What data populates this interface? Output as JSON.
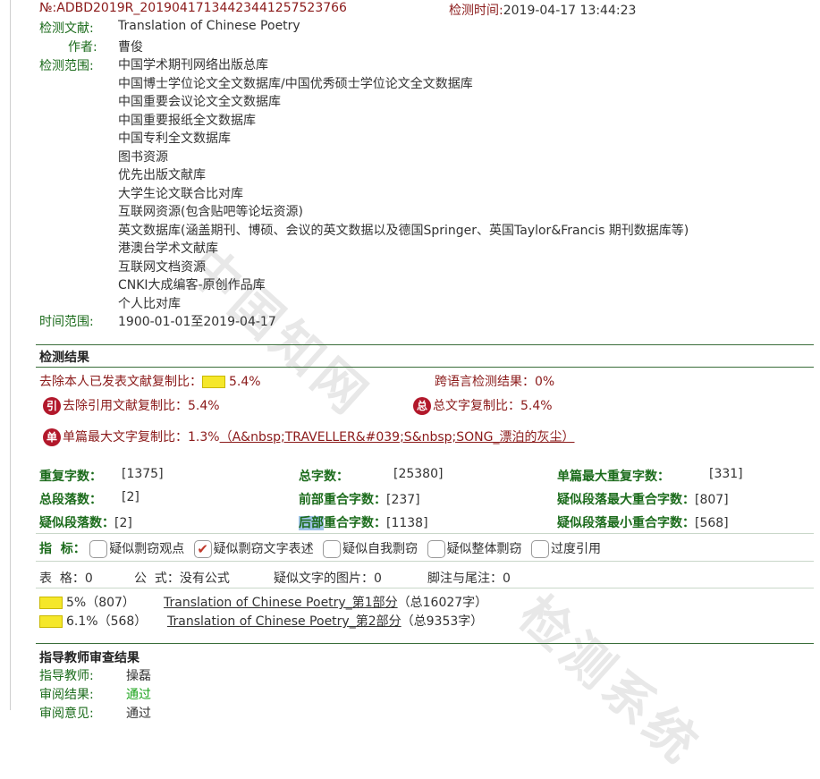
{
  "header": {
    "report_no": "№:ADBD2019R_20190417134423441257523766",
    "time_label": "检测时间:",
    "time_value": "2019-04-17 13:44:23"
  },
  "meta": {
    "doc_label": "检测文献:",
    "doc_value": "Translation of Chinese Poetry",
    "author_label": "作者:",
    "author_value": "曹俊",
    "range_label": "检测范围:",
    "databases": [
      "中国学术期刊网络出版总库",
      "中国博士学位论文全文数据库/中国优秀硕士学位论文全文数据库",
      "中国重要会议论文全文数据库",
      "中国重要报纸全文数据库",
      "中国专利全文数据库",
      "图书资源",
      "优先出版文献库",
      "大学生论文联合比对库",
      "互联网资源(包含贴吧等论坛资源)",
      "英文数据库(涵盖期刊、博硕、会议的英文数据以及德国Springer、英国Taylor&Francis 期刊数据库等)",
      "港澳台学术文献库",
      "互联网文档资源",
      "CNKI大成编客-原创作品库",
      "个人比对库"
    ],
    "time_range_label": "时间范围:",
    "time_range_value": "1900-01-01至2019-04-17"
  },
  "results": {
    "title": "检测结果",
    "self_excluded_label": "去除本人已发表文献复制比：",
    "self_excluded_value": "5.4%",
    "cross_lang": "跨语言检测结果：0%",
    "cite_excluded_badge": "引",
    "cite_excluded_label": "去除引用文献复制比：",
    "cite_excluded_value": "5.4%",
    "total_badge": "总",
    "total_label": "总文字复制比：",
    "total_value": "5.4%",
    "single_badge": "单",
    "single_label": "单篇最大文字复制比：",
    "single_value": "1.3%",
    "single_source": "（A&nbsp;TRAVELLER&#039;S&nbsp;SONG_漂泊的灰尘）",
    "stats": {
      "repeat_chars_label": "重复字数：",
      "repeat_chars_value": "[1375]",
      "total_chars_label": "总字数：",
      "total_chars_value": "[25380]",
      "single_max_label": "单篇最大重复字数：",
      "single_max_value": "[331]",
      "total_paras_label": "总段落数：",
      "total_paras_value": "[2]",
      "front_overlap_label_rest": "前部重合字数：",
      "front_overlap_value": "[237]",
      "susp_para_max_label": "疑似段落最大重合字数：",
      "susp_para_max_value": "[807]",
      "susp_paras_label": "疑似段落数：",
      "susp_paras_value": "[2]",
      "back_overlap_hl": "后部",
      "back_overlap_rest": "重合字数：",
      "back_overlap_value": "[1138]",
      "susp_para_min_label": "疑似段落最小重合字数：",
      "susp_para_min_value": "[568]"
    },
    "indicators_label": "指  标：",
    "indicators": [
      {
        "label": "疑似剽窃观点",
        "checked": false
      },
      {
        "label": "疑似剽窃文字表述",
        "checked": true
      },
      {
        "label": "疑似自我剽窃",
        "checked": false
      },
      {
        "label": "疑似整体剽窃",
        "checked": false
      },
      {
        "label": "过度引用",
        "checked": false
      }
    ],
    "misc": {
      "tables": "表  格：0",
      "formulas": "公  式：没有公式",
      "images": "疑似文字的图片：0",
      "footnotes": "脚注与尾注：0"
    },
    "parts": [
      {
        "pct": "5%（807）",
        "title": "Translation of Chinese Poetry_第1部分",
        "count": "（总16027字）"
      },
      {
        "pct": "6.1%（568）",
        "title": "Translation of Chinese Poetry_第2部分",
        "count": "（总9353字）"
      }
    ]
  },
  "review": {
    "title": "指导教师审查结果",
    "teacher_label": "指导教师:",
    "teacher_value": "操磊",
    "result_label": "审阅结果:",
    "result_value": "通过",
    "opinion_label": "审阅意见:",
    "opinion_value": "通过"
  },
  "watermark": "中国知网",
  "watermark2": "检测系统",
  "colors": {
    "label_green": "#1b6b1b",
    "label_red": "#8b1a1a",
    "badge_red": "#b2182b",
    "bar_yellow": "#f5e72a"
  }
}
